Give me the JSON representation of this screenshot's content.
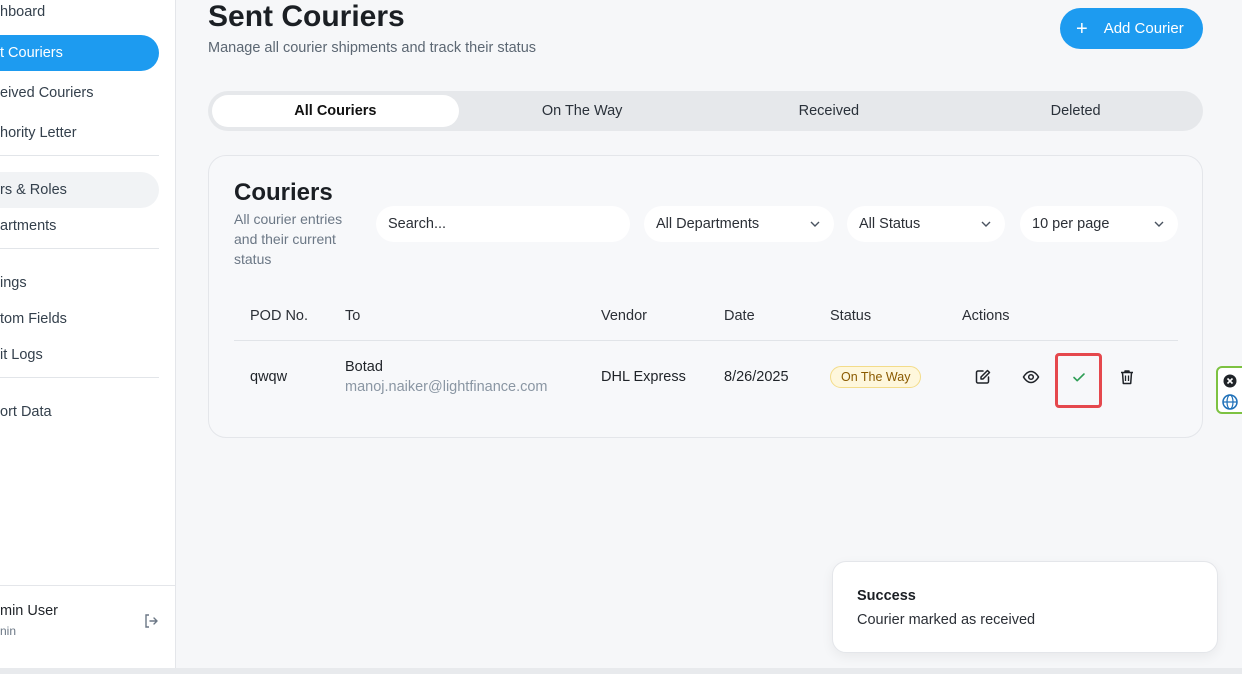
{
  "sidebar": {
    "items": [
      {
        "label": "hboard"
      },
      {
        "label": "t Couriers"
      },
      {
        "label": "eived Couriers"
      },
      {
        "label": "hority Letter"
      },
      {
        "label": "rs & Roles"
      },
      {
        "label": "artments"
      },
      {
        "label": "ings"
      },
      {
        "label": "tom Fields"
      },
      {
        "label": "it Logs"
      },
      {
        "label": "ort Data"
      }
    ],
    "user": {
      "name": "min User",
      "role": "nin"
    }
  },
  "header": {
    "title": "Sent Couriers",
    "subtitle": "Manage all courier shipments and track their status",
    "add_button": "Add Courier"
  },
  "tabs": [
    {
      "label": "All Couriers",
      "active": true
    },
    {
      "label": "On The Way"
    },
    {
      "label": "Received"
    },
    {
      "label": "Deleted"
    }
  ],
  "card": {
    "title": "Couriers",
    "subtitle": "All courier entries and their current status",
    "search_placeholder": "Search...",
    "department_filter": "All Departments",
    "status_filter": "All Status",
    "page_size": "10 per page",
    "columns": [
      "POD No.",
      "To",
      "Vendor",
      "Date",
      "Status",
      "Actions"
    ],
    "rows": [
      {
        "pod": "qwqw",
        "to_name": "Botad",
        "to_email": "manoj.naiker@lightfinance.com",
        "vendor": "DHL Express",
        "date": "8/26/2025",
        "status": "On The Way"
      }
    ]
  },
  "toast": {
    "title": "Success",
    "message": "Courier marked as received"
  },
  "colors": {
    "accent": "#1d9bf0",
    "badge_bg": "#fef7dc",
    "highlight": "#e5484d",
    "success_check": "#2e9e55"
  }
}
